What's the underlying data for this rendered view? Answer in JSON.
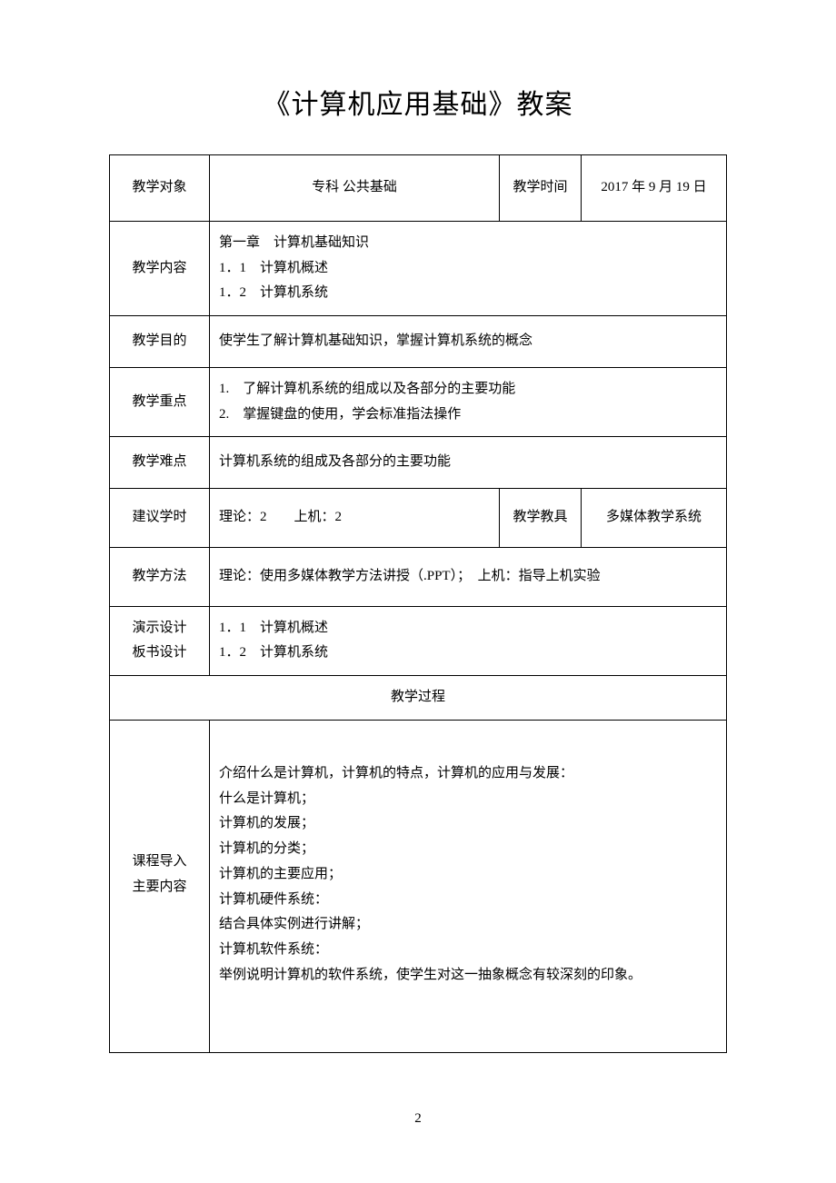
{
  "title": "《计算机应用基础》教案",
  "rows": {
    "subject": {
      "label": "教学对象",
      "value": "专科 公共基础"
    },
    "time": {
      "label": "教学时间",
      "value": "2017 年 9 月 19 日"
    },
    "content": {
      "label": "教学内容",
      "value": "第一章　计算机基础知识\n1．1　计算机概述\n1．2　计算机系统"
    },
    "purpose": {
      "label": "教学目的",
      "value": "使学生了解计算机基础知识，掌握计算机系统的概念"
    },
    "keypoint": {
      "label": "教学重点",
      "value": "1.　了解计算机系统的组成以及各部分的主要功能\n2.　掌握键盘的使用，学会标准指法操作"
    },
    "difficulty": {
      "label": "教学难点",
      "value": "计算机系统的组成及各部分的主要功能"
    },
    "hours": {
      "label": "建议学时",
      "value": "理论：2　　上机：2"
    },
    "aids": {
      "label": "教学教具",
      "value": "多媒体教学系统"
    },
    "method": {
      "label": "教学方法",
      "value": "理论：使用多媒体教学方法讲授（.PPT）；　上机：指导上机实验"
    },
    "design": {
      "label": "演示设计\n板书设计",
      "value": "1．1　计算机概述\n1．2　计算机系统"
    },
    "process_header": "教学过程",
    "intro": {
      "label": "课程导入\n主要内容",
      "value": "介绍什么是计算机，计算机的特点，计算机的应用与发展：\n什么是计算机；\n计算机的发展；\n计算机的分类；\n计算机的主要应用；\n计算机硬件系统：\n结合具体实例进行讲解；\n计算机软件系统：\n举例说明计算机的软件系统，使学生对这一抽象概念有较深刻的印象。"
    }
  },
  "page_number": "2"
}
